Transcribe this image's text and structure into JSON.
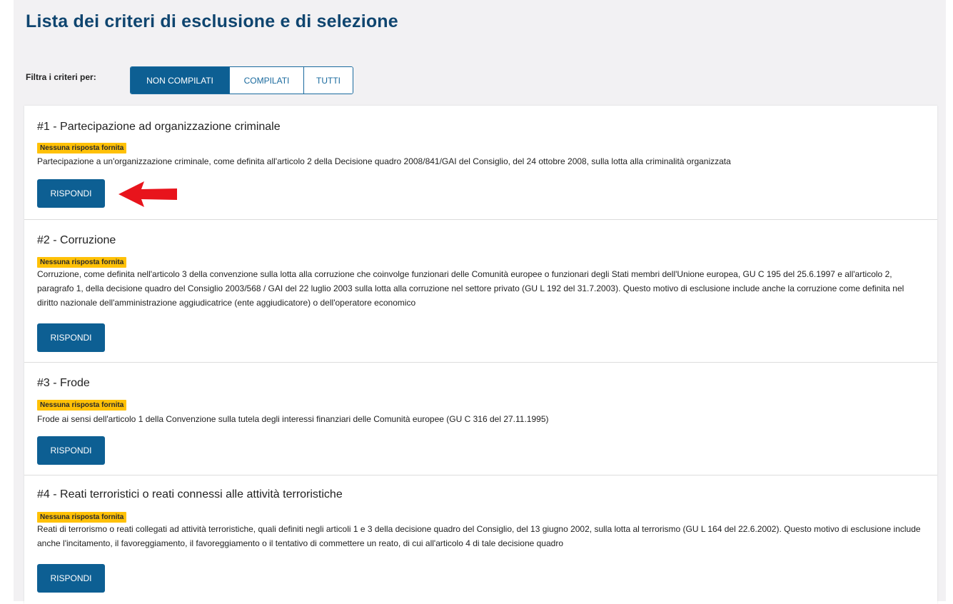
{
  "page": {
    "title": "Lista dei criteri di esclusione e di selezione"
  },
  "filter": {
    "label": "Filtra i criteri per:",
    "options": [
      "NON COMPILATI",
      "COMPILATI",
      "TUTTI"
    ],
    "selected": "NON COMPILATI"
  },
  "criteria": [
    {
      "title": "#1 - Partecipazione ad organizzazione criminale",
      "badge": "Nessuna risposta fornita",
      "description": "Partecipazione a un'organizzazione criminale, come definita all'articolo 2 della Decisione quadro 2008/841/GAI del Consiglio, del 24 ottobre 2008, sulla lotta alla criminalità organizzata",
      "button": "RISPONDI"
    },
    {
      "title": "#2 - Corruzione",
      "badge": "Nessuna risposta fornita",
      "description": "Corruzione, come definita nell'articolo 3 della convenzione sulla lotta alla corruzione che coinvolge funzionari delle Comunità europee o funzionari degli Stati membri dell'Unione europea, GU C 195 del 25.6.1997 e all'articolo 2, paragrafo 1, della decisione quadro del Consiglio 2003/568 / GAI del 22 luglio 2003 sulla lotta alla corruzione nel settore privato (GU L 192 del 31.7.2003). Questo motivo di esclusione include anche la corruzione come definita nel diritto nazionale dell'amministrazione aggiudicatrice (ente aggiudicatore) o dell'operatore economico",
      "button": "RISPONDI"
    },
    {
      "title": "#3 - Frode",
      "badge": "Nessuna risposta fornita",
      "description": "Frode ai sensi dell'articolo 1 della Convenzione sulla tutela degli interessi finanziari delle Comunità europee (GU C 316 del 27.11.1995)",
      "button": "RISPONDI"
    },
    {
      "title": "#4 - Reati terroristici o reati connessi alle attività terroristiche",
      "badge": "Nessuna risposta fornita",
      "description": "Reati di terrorismo o reati collegati ad attività terroristiche, quali definiti negli articoli 1 e 3 della decisione quadro del Consiglio, del 13 giugno 2002, sulla lotta al terrorismo (GU L 164 del 22.6.2002). Questo motivo di esclusione include anche l'incitamento, il favoreggiamento, il favoreggiamento o il tentativo di commettere un reato, di cui all'articolo 4 di tale decisione quadro",
      "button": "RISPONDI"
    }
  ],
  "colors": {
    "title": "#0f456f",
    "primary": "#0d5f93",
    "badge": "#ffc107",
    "annotation_arrow": "#e8141c"
  },
  "annotation": {
    "icon": "red-arrow-icon"
  }
}
